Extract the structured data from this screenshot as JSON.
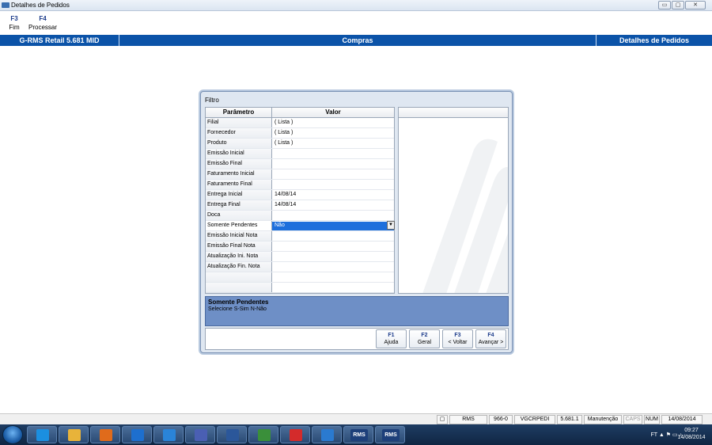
{
  "window": {
    "title": "Detalhes de Pedidos",
    "buttons": [
      "▭",
      "▢",
      "✕"
    ]
  },
  "fkeys": [
    {
      "key": "F3",
      "label": "Fim"
    },
    {
      "key": "F4",
      "label": "Processar"
    }
  ],
  "header": {
    "app": "G-RMS Retail 5.681 MID",
    "module": "Compras",
    "screen": "Detalhes de Pedidos"
  },
  "dialog": {
    "title": "Filtro",
    "columns": {
      "param": "Parâmetro",
      "value": "Valor"
    },
    "rows": [
      {
        "param": "Filial",
        "value": "( Lista )"
      },
      {
        "param": "Fornecedor",
        "value": "( Lista )"
      },
      {
        "param": "Produto",
        "value": "( Lista )"
      },
      {
        "param": "Emissão Inicial",
        "value": ""
      },
      {
        "param": "Emissão Final",
        "value": ""
      },
      {
        "param": "Faturamento Inicial",
        "value": ""
      },
      {
        "param": "Faturamento Final",
        "value": ""
      },
      {
        "param": "Entrega Inicial",
        "value": "14/08/14"
      },
      {
        "param": "Entrega Final",
        "value": "14/08/14"
      },
      {
        "param": "Doca",
        "value": ""
      },
      {
        "param": "Somente Pendentes",
        "value": "Não"
      },
      {
        "param": "Emissão Inicial Nota",
        "value": ""
      },
      {
        "param": "Emissão Final Nota",
        "value": ""
      },
      {
        "param": "Atualização Ini. Nota",
        "value": ""
      },
      {
        "param": "Atualização Fin. Nota",
        "value": ""
      },
      {
        "param": "",
        "value": ""
      },
      {
        "param": "",
        "value": ""
      }
    ],
    "selected_row": 10,
    "help": {
      "title": "Somente Pendentes",
      "desc": "Selecione S-Sim N-Não"
    },
    "buttons": [
      {
        "key": "F1",
        "label": "Ajuda"
      },
      {
        "key": "F2",
        "label": "Geral"
      },
      {
        "key": "F3",
        "label": "< Voltar"
      },
      {
        "key": "F4",
        "label": "Avançar >"
      }
    ]
  },
  "status": [
    "RMS",
    "966-0",
    "VGCRPEDI",
    "5.681.1",
    "Manutenção",
    "CAPS",
    "NUM",
    "14/08/2014"
  ],
  "taskbar": {
    "apps": [
      "IE",
      "Explorer",
      "Media",
      "Outlook",
      "Lync",
      "App",
      "Word",
      "Tool",
      "PDF",
      "Net",
      "RMS",
      "RMS"
    ],
    "tray_text": "FT",
    "time": "09:27",
    "date": "14/08/2014"
  }
}
